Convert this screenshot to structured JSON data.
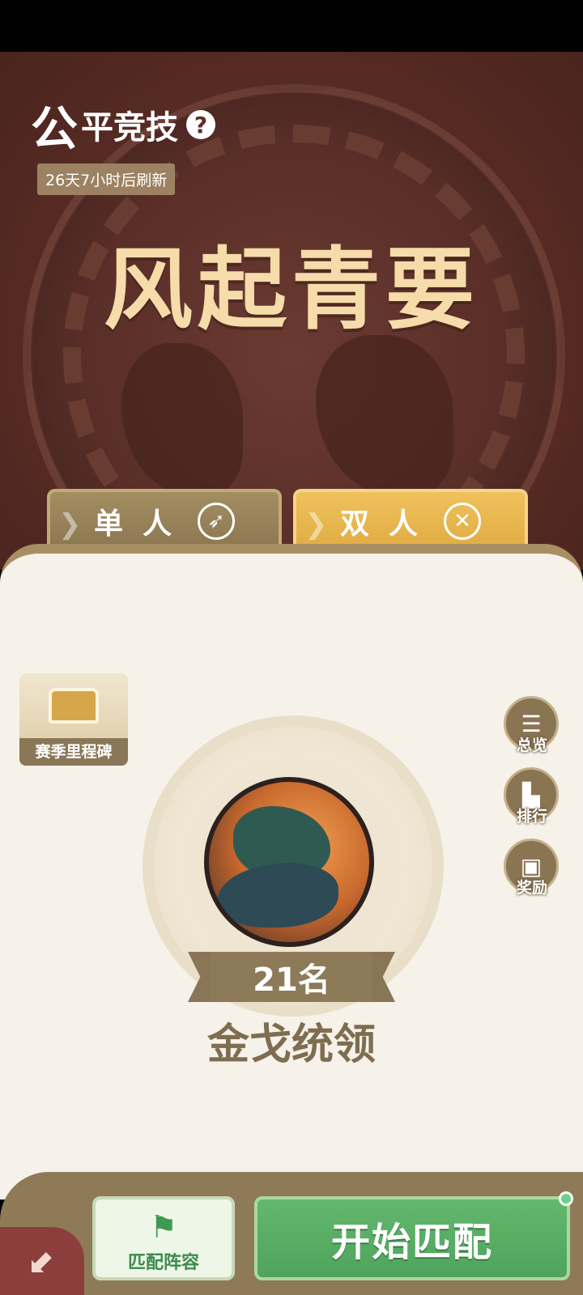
{
  "header": {
    "title_first": "公",
    "title_rest": "平竞技",
    "help_glyph": "?",
    "refresh_text": "26天7小时后刷新"
  },
  "season": {
    "name": "风起青要"
  },
  "mode_tabs": [
    {
      "label": "单人",
      "icon": "spear-icon",
      "selected": false
    },
    {
      "label": "双人",
      "icon": "crossed-axes-icon",
      "selected": true
    }
  ],
  "milestone": {
    "label": "赛季里程碑"
  },
  "side_menu": [
    {
      "label": "总览",
      "icon": "list-icon"
    },
    {
      "label": "排行",
      "icon": "podium-icon"
    },
    {
      "label": "奖励",
      "icon": "chest-icon"
    }
  ],
  "rank": {
    "position_text": "21名",
    "title": "金戈统领"
  },
  "bottom": {
    "lineup_label": "匹配阵容",
    "start_label": "开始匹配"
  },
  "colors": {
    "hero_bg": "#5c2e26",
    "season_text": "#f6dcaa",
    "tab_selected": "#e0ac43",
    "tab_unselected": "#8b7650",
    "panel_bg": "#f6f2ea",
    "start_green": "#4fa35d"
  }
}
